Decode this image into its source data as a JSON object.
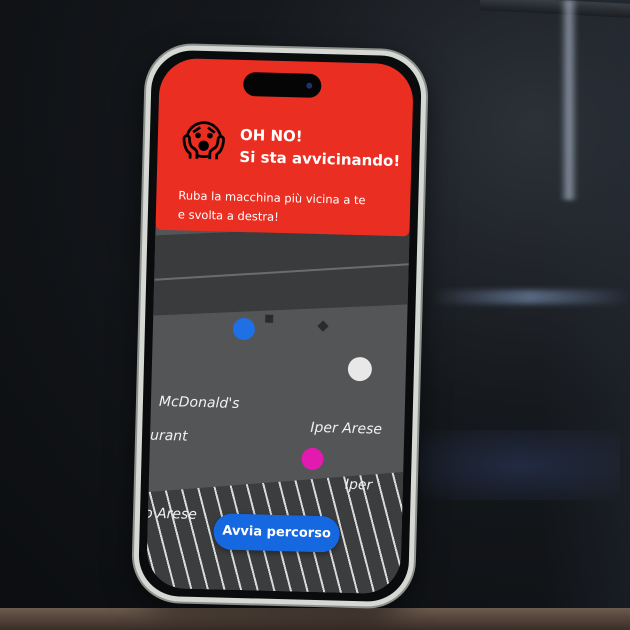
{
  "alert": {
    "emoji": "😱",
    "title_line1": "OH NO!",
    "title_line2": "Si sta avvicinando!",
    "body_line1": "Ruba la macchina più vicina a te",
    "body_line2": "e svolta a destra!",
    "background_color": "#ea2f22"
  },
  "map": {
    "labels": [
      "McDonald's",
      "urant",
      "Iper Arese",
      "Iper",
      "o Arese"
    ],
    "markers": [
      {
        "name": "blue-marker",
        "color": "#1f6fe5"
      },
      {
        "name": "white-marker",
        "color": "#e8e8e8"
      },
      {
        "name": "pink-marker",
        "color": "#e21ab0"
      }
    ]
  },
  "actions": {
    "start_route_label": "Avvia percorso",
    "accent_color": "#1668e0"
  }
}
